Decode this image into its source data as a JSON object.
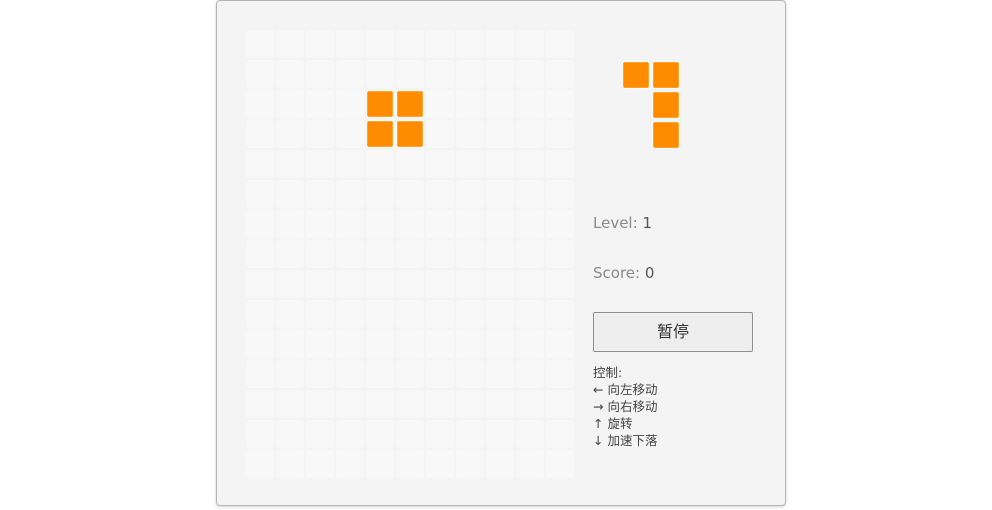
{
  "game": {
    "level_label": "Level:",
    "level_value": "1",
    "score_label": "Score:",
    "score_value": "0",
    "pause_label": "暂停",
    "controls_title": "控制:",
    "controls": [
      "← 向左移动",
      "→ 向右移动",
      "↑ 旋转",
      "↓ 加速下落"
    ]
  },
  "board": {
    "columns": 11,
    "rows": 15,
    "filled_cells": [
      [
        4,
        2
      ],
      [
        5,
        2
      ],
      [
        4,
        3
      ],
      [
        5,
        3
      ]
    ]
  },
  "next_piece": {
    "cells": [
      [
        0,
        0
      ],
      [
        1,
        0
      ],
      [
        1,
        1
      ],
      [
        1,
        2
      ]
    ]
  },
  "colors": {
    "piece": "#ff8c00",
    "empty_cell": "#f8f8f8",
    "panel_bg": "#f4f4f4"
  }
}
